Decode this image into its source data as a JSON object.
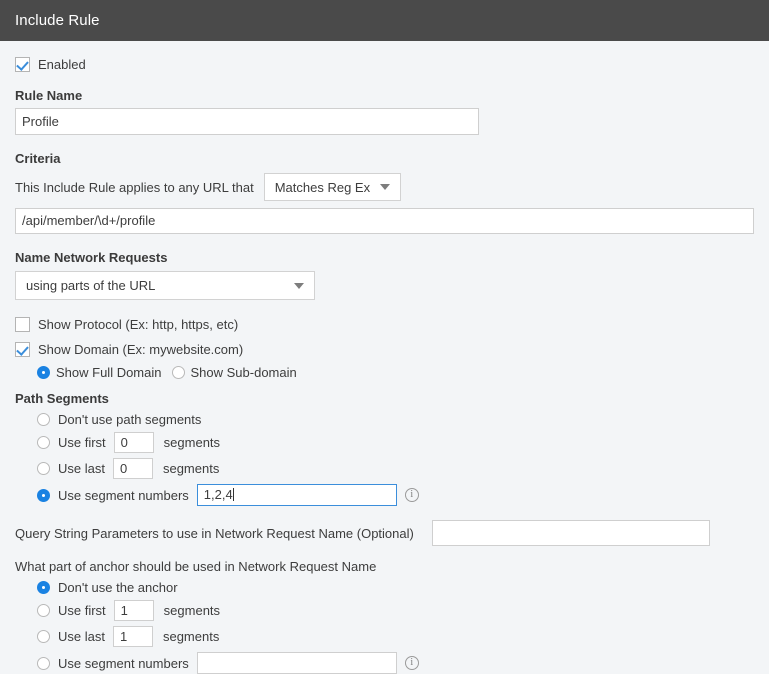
{
  "window": {
    "title": "Include Rule"
  },
  "enabled": {
    "label": "Enabled",
    "checked": true
  },
  "rule_name": {
    "label": "Rule Name",
    "value": "Profile"
  },
  "criteria": {
    "label": "Criteria",
    "prefix_text": "This Include Rule applies to any URL that",
    "match_type": "Matches Reg Ex",
    "pattern": "/api/member/\\d+/profile"
  },
  "name_network_requests": {
    "label": "Name Network Requests",
    "mode": "using parts of the URL"
  },
  "show_protocol": {
    "label": "Show Protocol (Ex: http, https, etc)",
    "checked": false
  },
  "show_domain": {
    "label": "Show Domain (Ex: mywebsite.com)",
    "checked": true,
    "options": [
      {
        "label": "Show Full Domain",
        "selected": true
      },
      {
        "label": "Show Sub-domain",
        "selected": false
      }
    ]
  },
  "path_segments": {
    "label": "Path Segments",
    "option_none": "Don't use path segments",
    "option_first": "Use first",
    "option_last": "Use last",
    "option_numbers": "Use segment numbers",
    "segments_word": "segments",
    "first_value": "0",
    "last_value": "0",
    "numbers_value": "1,2,4",
    "selected": "numbers",
    "info_icon": "info-circle-icon"
  },
  "query_string": {
    "label": "Query String Parameters to use in Network Request Name (Optional)",
    "value": ""
  },
  "anchor": {
    "label": "What part of anchor should be used in Network Request Name",
    "option_none": "Don't use the anchor",
    "option_first": "Use first",
    "option_last": "Use last",
    "option_numbers": "Use segment numbers",
    "segments_word": "segments",
    "first_value": "1",
    "last_value": "1",
    "numbers_value": "",
    "selected": "none",
    "info_icon": "info-circle-icon"
  },
  "icons": {
    "dropdown": "chevron-down-icon",
    "checkmark": "check-icon"
  },
  "colors": {
    "header_bg": "#4a4a4a",
    "page_bg": "#f3f5f7",
    "accent": "#1a82e2",
    "check": "#3b8edb",
    "focus_border": "#3b8edb"
  }
}
